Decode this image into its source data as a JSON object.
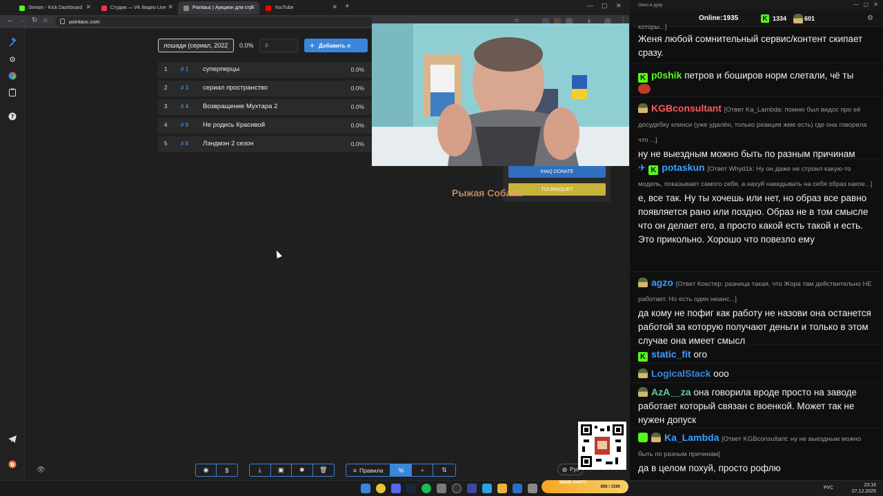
{
  "browser": {
    "tabs": [
      {
        "label": "Stream - Kick Dashboard",
        "color": "#53fc18"
      },
      {
        "label": "Студия — VK Видео Live",
        "color": "#ff3347"
      },
      {
        "label": "Pointauc | Аукцион для стрима",
        "color": "#888888"
      },
      {
        "label": "YouTube",
        "color": "#ff0000"
      }
    ],
    "url": "pointauc.com"
  },
  "auction": {
    "lot_input_value": "лошади (сериал, 2022)",
    "lot_percent": "0.0%",
    "amount_placeholder": "₽",
    "add_button_label": "Добавить л",
    "lots": [
      {
        "index": "1",
        "id": "# 1",
        "name": "суперперцы",
        "percent": "0.0%"
      },
      {
        "index": "2",
        "id": "# 3",
        "name": "сериал пространство",
        "percent": "0.0%"
      },
      {
        "index": "3",
        "id": "# 4",
        "name": "Возвращение Мухтара 2",
        "percent": "0.0%"
      },
      {
        "index": "4",
        "id": "# 5",
        "name": "Не родись Красивой",
        "percent": "0.0%"
      },
      {
        "index": "5",
        "id": "# 6",
        "name": "Лэндмэн 2 сезон",
        "percent": "0.0%"
      }
    ],
    "donate_buttons": [
      "IHAQ DONATE",
      "TOURNIQUET"
    ],
    "overlay_text": "Рыжая Собака",
    "toolbar": {
      "rules_label": "Правила",
      "percent_label": "%",
      "lang_label": "Рус"
    }
  },
  "chat": {
    "window_title": "Окно в дуку",
    "online_label": "Online:",
    "online_count": "1935",
    "kick_count": "1334",
    "other_count": "601",
    "messages": [
      {
        "user": "",
        "user_color": "#ffffff",
        "reply": "которы...]",
        "text": "Женя любой сомнительный сервис/контент скипает сразу."
      },
      {
        "user": "p0shik",
        "user_color": "#53fc18",
        "reply": "",
        "text": "петров и боширов норм слетали, чё ты"
      },
      {
        "user": "KGBconsultant",
        "user_color": "#ff5a5a",
        "reply": "[Ответ Ka_Lambda: помню был видос про её досудебку клинси (уже удалён, только реакция жме есть) где она говорила что ...]",
        "text": "ну не выездным можно быть по разным причинам"
      },
      {
        "user": "potaskun",
        "user_color": "#3aa0ff",
        "reply": "[Ответ Whyd1k: Ну он даже не строил какую-то модель, показывает самого себя, а нахуй накидывать на себя образ какое...]",
        "text": "е, все так. Ну ты хочешь или нет, но образ все равно появляется рано или поздно. Образ не в том смысле что он делает его, а просто какой есть такой и есть. Это прикольно. Хорошо что повезло ему"
      },
      {
        "user": "agzo",
        "user_color": "#3aa0ff",
        "reply": "[Ответ Кокстер: разница такая, что Жора там действительно НЕ работает. Но есть один нюанс...]",
        "text": "да кому не пофиг как работу не назови она останется работой за которую получают деньги и только в этом случае она имеет смысл"
      },
      {
        "user": "static_fit",
        "user_color": "#3aa0ff",
        "reply": "",
        "text": "ого"
      },
      {
        "user": "LogicalStack",
        "user_color": "#3a86d9",
        "reply": "",
        "text": "ооо"
      },
      {
        "user": "AzA__za",
        "user_color": "#5ad0a0",
        "reply": "",
        "text": "она говорила вроде просто на заводе работает который связан с военкой. Может так не нужен допуск"
      },
      {
        "user": "Ka_Lambda",
        "user_color": "#3aa0ff",
        "reply": "[Ответ KGBconsultant: ну не выездным можно быть по разным причинам]",
        "text": "да в целом похуй, просто рофлю"
      }
    ]
  },
  "widgets": {
    "meme_label": "MEME PARTY",
    "meme_progress": "890 / 1590"
  },
  "taskbar": {
    "lang": "РУС",
    "time": "23:16",
    "date": "07.12.2025"
  }
}
